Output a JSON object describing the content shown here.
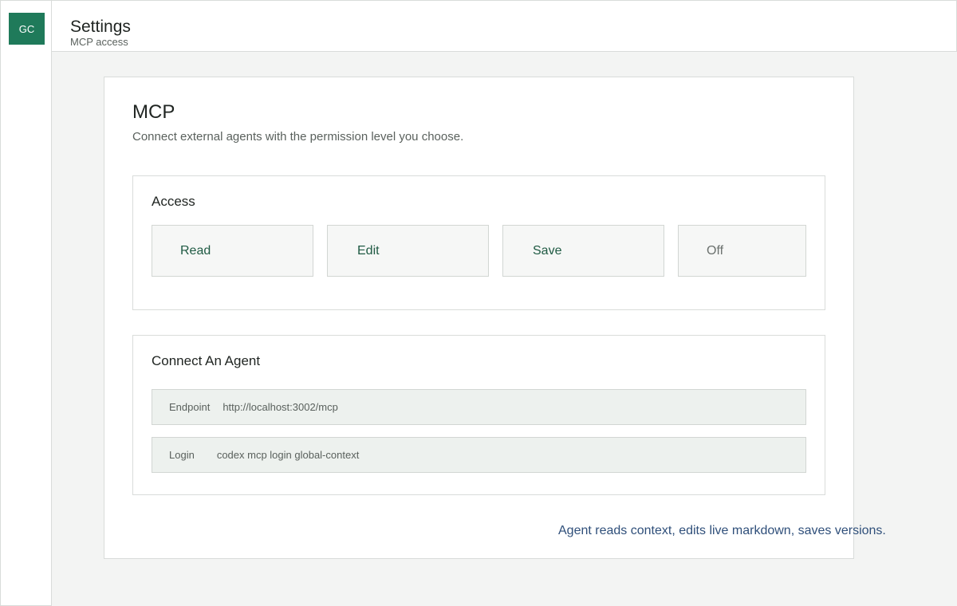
{
  "app": {
    "logo_text": "GC"
  },
  "header": {
    "title": "Settings",
    "subtitle": "MCP access"
  },
  "card": {
    "title": "MCP",
    "description": "Connect external agents with the permission level you choose."
  },
  "access": {
    "title": "Access",
    "options": [
      {
        "label": "Read"
      },
      {
        "label": "Edit"
      },
      {
        "label": "Save"
      },
      {
        "label": "Off"
      }
    ]
  },
  "connect": {
    "title": "Connect An Agent",
    "endpoint": {
      "label": "Endpoint",
      "value": "http://localhost:3002/mcp"
    },
    "login": {
      "label": "Login",
      "value": "codex mcp login global-context"
    }
  },
  "footnote": "Agent reads context, edits live markdown, saves versions.",
  "colors": {
    "brand": "#1f7a5a",
    "option_text": "#1f5a43",
    "footnote": "#2f4f7a"
  }
}
